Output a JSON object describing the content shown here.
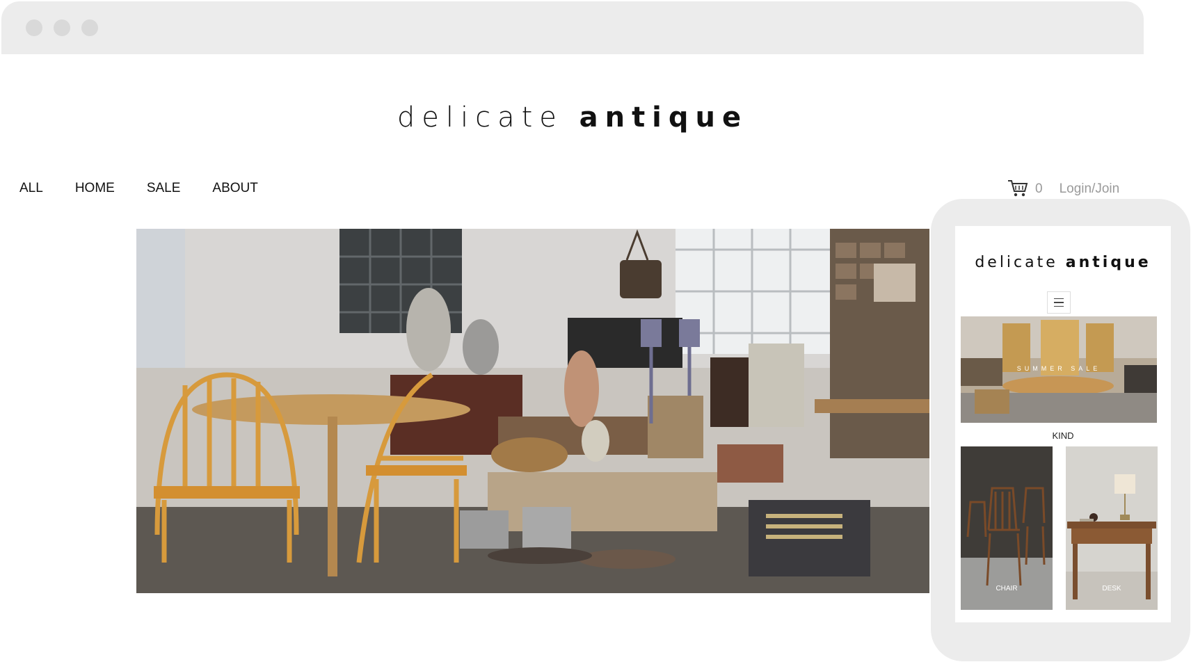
{
  "site": {
    "logo_light": "delicate",
    "logo_bold": "antique"
  },
  "nav": {
    "items": [
      "ALL",
      "HOME",
      "SALE",
      "ABOUT"
    ]
  },
  "cart": {
    "count": "0",
    "login_label": "Login/Join"
  },
  "hero": {
    "image": "photo-antique-shop-storefront"
  },
  "mobile": {
    "logo_light": "delicate",
    "logo_bold": "antique",
    "menu_icon": "hamburger-icon",
    "banner_text": "SUMMER SALE",
    "section_title": "KIND",
    "cards": [
      {
        "label": "CHAIR"
      },
      {
        "label": "DESK"
      }
    ]
  },
  "colors": {
    "frame": "#ececec",
    "dot": "#d9d9d9",
    "muted_text": "#9a9a9a"
  }
}
